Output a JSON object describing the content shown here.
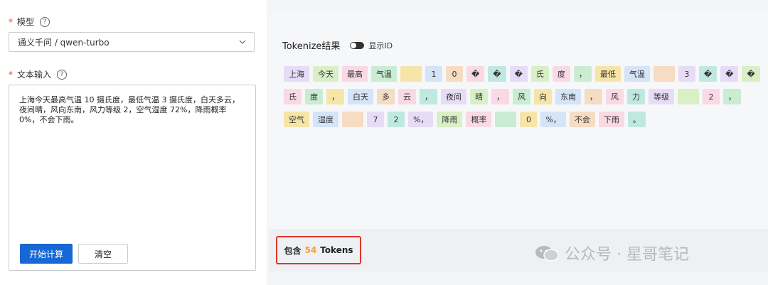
{
  "model_field": {
    "label": "模型",
    "value": "通义千问 / qwen-turbo"
  },
  "text_field": {
    "label": "文本输入",
    "value": "上海今天最高气温 10 摄氏度，最低气温 3 摄氏度，白天多云，\n夜间晴，风向东南，风力等级 2，空气湿度 72%，降雨概率\n0%，不会下雨。"
  },
  "buttons": {
    "compute": "开始计算",
    "clear": "清空"
  },
  "tokenize": {
    "title": "Tokenize结果",
    "toggle_label": "显示ID"
  },
  "tokens": [
    {
      "t": "上海",
      "c": "c0"
    },
    {
      "t": "今天",
      "c": "c1"
    },
    {
      "t": "最高",
      "c": "c2"
    },
    {
      "t": "气温",
      "c": "c7"
    },
    {
      "t": "",
      "c": "c3"
    },
    {
      "t": "1",
      "c": "c4"
    },
    {
      "t": "0",
      "c": "c6"
    },
    {
      "t": "�",
      "c": "c2"
    },
    {
      "t": "�",
      "c": "c5"
    },
    {
      "t": "�",
      "c": "c0"
    },
    {
      "t": "氏",
      "c": "c1"
    },
    {
      "t": "度",
      "c": "c2"
    },
    {
      "t": "，",
      "c": "c7"
    },
    {
      "t": "最低",
      "c": "c3"
    },
    {
      "t": "气温",
      "c": "c4"
    },
    {
      "t": "",
      "c": "c6"
    },
    {
      "t": "3",
      "c": "c0"
    },
    {
      "t": "�",
      "c": "c5"
    },
    {
      "t": "�",
      "c": "c0"
    },
    {
      "t": "�",
      "c": "c1"
    },
    {
      "t": "氏",
      "c": "c2"
    },
    {
      "t": "度",
      "c": "c7"
    },
    {
      "t": "，",
      "c": "c3"
    },
    {
      "t": "白天",
      "c": "c4"
    },
    {
      "t": "多",
      "c": "c6"
    },
    {
      "t": "云",
      "c": "c2"
    },
    {
      "t": "，",
      "c": "c5"
    },
    {
      "t": "夜间",
      "c": "c0"
    },
    {
      "t": "晴",
      "c": "c1"
    },
    {
      "t": "，",
      "c": "c2"
    },
    {
      "t": "风",
      "c": "c7"
    },
    {
      "t": "向",
      "c": "c3"
    },
    {
      "t": "东南",
      "c": "c4"
    },
    {
      "t": "，",
      "c": "c6"
    },
    {
      "t": "风",
      "c": "c2"
    },
    {
      "t": "力",
      "c": "c5"
    },
    {
      "t": "等级",
      "c": "c0"
    },
    {
      "t": "",
      "c": "c1"
    },
    {
      "t": "2",
      "c": "c2"
    },
    {
      "t": "，",
      "c": "c7"
    },
    {
      "t": "空气",
      "c": "c3"
    },
    {
      "t": "湿度",
      "c": "c4"
    },
    {
      "t": "",
      "c": "c6"
    },
    {
      "t": "7",
      "c": "c0"
    },
    {
      "t": "2",
      "c": "c5"
    },
    {
      "t": "%，",
      "c": "c0"
    },
    {
      "t": "降雨",
      "c": "c1"
    },
    {
      "t": "概率",
      "c": "c2"
    },
    {
      "t": "",
      "c": "c7"
    },
    {
      "t": "0",
      "c": "c3"
    },
    {
      "t": "%，",
      "c": "c4"
    },
    {
      "t": "不会",
      "c": "c6"
    },
    {
      "t": "下雨",
      "c": "c2"
    },
    {
      "t": "。",
      "c": "c5"
    }
  ],
  "summary": {
    "prefix": "包含",
    "count": "54",
    "suffix": "Tokens"
  },
  "watermark": {
    "text": "公众号 · 星哥笔记",
    "icon": "wechat-icon"
  }
}
